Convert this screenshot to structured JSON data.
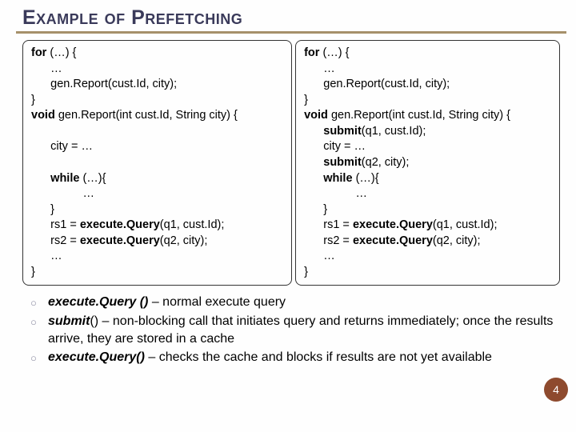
{
  "title": "Example of Prefetching",
  "code_left": {
    "l1a": "for ",
    "l1b": "(…) {",
    "l2": "      …",
    "l3": "      gen.Report(cust.Id, city);",
    "l4": "}",
    "l5a": "void ",
    "l5b": "gen.Report(int cust.Id, String city) {",
    "l6": "",
    "l7": "      city = …",
    "l8": "",
    "l9a": "      while ",
    "l9b": "(…){",
    "l10": "                …",
    "l11": "      }",
    "l12a": "      rs1 = ",
    "l12b": "execute.Query",
    "l12c": "(q1, cust.Id);",
    "l13a": "      rs2 = ",
    "l13b": "execute.Query",
    "l13c": "(q2, city);",
    "l14": "      …",
    "l15": "}"
  },
  "code_right": {
    "l1a": "for ",
    "l1b": "(…) {",
    "l2": "      …",
    "l3": "      gen.Report(cust.Id, city);",
    "l4": "}",
    "l5a": "void ",
    "l5b": "gen.Report(int cust.Id, String city) {",
    "l6a": "      submit",
    "l6b": "(q1, cust.Id);",
    "l7": "      city = …",
    "l8a": "      submit",
    "l8b": "(q2, city);",
    "l9a": "      while ",
    "l9b": "(…){",
    "l10": "                …",
    "l11": "      }",
    "l12a": "      rs1 = ",
    "l12b": "execute.Query",
    "l12c": "(q1, cust.Id);",
    "l13a": "      rs2 = ",
    "l13b": "execute.Query",
    "l13c": "(q2, city);",
    "l14": "      …",
    "l15": "}"
  },
  "bullets": {
    "b1a": "execute.Query ()",
    "b1b": " – normal execute query",
    "b2a": "submit",
    "b2b": "() – non-blocking call that initiates query and returns immediately; once the results arrive, they are stored in a cache",
    "b3a": "execute.Query()",
    "b3b": " – checks the cache and blocks if results are not yet available"
  },
  "page": "4"
}
